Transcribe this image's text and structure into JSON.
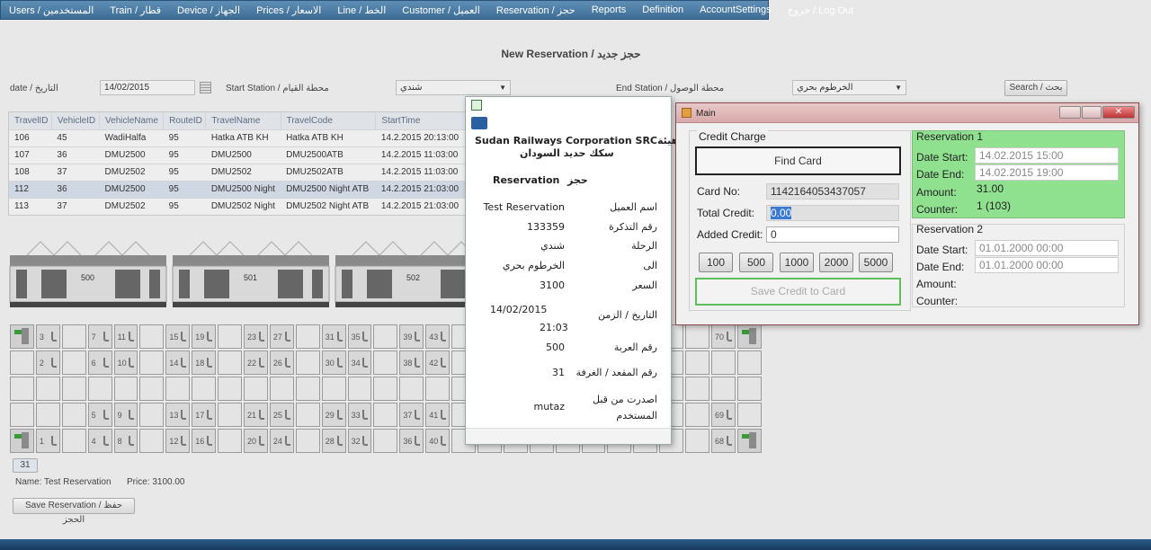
{
  "menu": [
    "Users / المستخدمين",
    "Train / قطار",
    "Device / الجهاز",
    "Prices / الاسعار",
    "Line / الخط",
    "Customer / العميل",
    "Reservation / حجز",
    "Reports",
    "Definition",
    "AccountSettings",
    "خروج / Log Out"
  ],
  "page_title": "New Reservation / حجز جديد",
  "filters": {
    "date_label": "date / التاريخ",
    "date_value": "14/02/2015",
    "start_label": "Start Station / محطة القيام",
    "start_value": "شندي",
    "end_label": "End Station / محطة الوصول",
    "end_value": "الخرطوم بحري",
    "search_label": "Search / بحث"
  },
  "grid": {
    "columns": [
      "TravelID",
      "VehicleID",
      "VehicleName",
      "RouteID",
      "TravelName",
      "TravelCode",
      "StartTime"
    ],
    "rows": [
      [
        "106",
        "45",
        "WadiHalfa",
        "95",
        "Hatka ATB KH",
        "Hatka ATB KH",
        "14.2.2015 20:13:00"
      ],
      [
        "107",
        "36",
        "DMU2500",
        "95",
        "DMU2500",
        "DMU2500ATB",
        "14.2.2015 11:03:00"
      ],
      [
        "108",
        "37",
        "DMU2502",
        "95",
        "DMU2502",
        "DMU2502ATB",
        "14.2.2015 11:03:00"
      ],
      [
        "112",
        "36",
        "DMU2500",
        "95",
        "DMU2500 Night",
        "DMU2500 Night ATB",
        "14.2.2015 21:03:00"
      ],
      [
        "113",
        "37",
        "DMU2502",
        "95",
        "DMU2502 Night",
        "DMU2502 Night ATB",
        "14.2.2015 21:03:00"
      ]
    ],
    "selected_row": 3
  },
  "cars": [
    "500",
    "501",
    "502"
  ],
  "seat_rows": [
    [
      "D",
      "3",
      "",
      "7",
      "11",
      "",
      "15",
      "19",
      "",
      "23",
      "27",
      "",
      "31",
      "35",
      "",
      "39",
      "43",
      "",
      "",
      "",
      "",
      "",
      "",
      "",
      "",
      "",
      "",
      "70",
      "D"
    ],
    [
      "",
      "2",
      "",
      "6",
      "10",
      "",
      "14",
      "18",
      "",
      "22",
      "26",
      "",
      "30",
      "34",
      "",
      "38",
      "42",
      "",
      "",
      "",
      "",
      "",
      "",
      "",
      "",
      "",
      "",
      "",
      ""
    ],
    [
      "",
      "",
      "",
      "",
      "",
      "",
      "",
      "",
      "",
      "",
      "",
      "",
      "",
      "",
      "",
      "",
      "",
      "",
      "",
      "",
      "",
      "",
      "",
      "",
      "",
      "",
      "",
      "",
      ""
    ],
    [
      "",
      "",
      "",
      "5",
      "9",
      "",
      "13",
      "17",
      "",
      "21",
      "25",
      "",
      "29",
      "33",
      "",
      "37",
      "41",
      "",
      "",
      "",
      "",
      "",
      "",
      "",
      "",
      "",
      "",
      "69",
      ""
    ],
    [
      "D",
      "1",
      "",
      "4",
      "8",
      "",
      "12",
      "16",
      "",
      "20",
      "24",
      "",
      "28",
      "32",
      "",
      "36",
      "40",
      "",
      "",
      "",
      "",
      "",
      "",
      "",
      "",
      "",
      "",
      "68",
      "D"
    ]
  ],
  "selected_seat": "31",
  "summary": {
    "name": "Name: Test Reservation",
    "price": "Price: 3100.00",
    "save": "Save Reservation / حفظ الحجز"
  },
  "ticket": {
    "company": "Sudan Railways Corporation SRCهيئة",
    "company2": "سكك حديد السودان",
    "heading_en": "Reservation",
    "heading_ar": "حجز",
    "rows": [
      {
        "label": "اسم العميل",
        "value": "Test Reservation"
      },
      {
        "label": "رقم التذكرة",
        "value": "133359"
      },
      {
        "label": "الرحلة",
        "value": "شندي"
      },
      {
        "label": "الى",
        "value": "الخرطوم بحري"
      },
      {
        "label": "السعر",
        "value": "3100"
      }
    ],
    "datetime_label": "التاريخ / الزمن",
    "date": "14/02/2015",
    "time": "21:03",
    "car_label": "رقم العربة",
    "car": "500",
    "seat_label": "رقم المقعد / الغرفة",
    "seat": "31",
    "issued_label1": "اصدرت من قبل",
    "issued_label2": "المستخدم",
    "issued_by": "mutaz"
  },
  "main_window": {
    "title": "Main",
    "credit_charge": "Credit Charge",
    "find_card": "Find Card",
    "card_no_label": "Card No:",
    "card_no": "1142164053437057",
    "total_credit_label": "Total Credit:",
    "total_credit": "0.00",
    "added_credit_label": "Added Credit:",
    "added_credit": "0",
    "amounts": [
      "100",
      "500",
      "1000",
      "2000",
      "5000"
    ],
    "save_credit": "Save Credit to Card",
    "res1": {
      "title": "Reservation 1",
      "date_start_label": "Date Start:",
      "date_start": "14.02.2015 15:00",
      "date_end_label": "Date End:",
      "date_end": "14.02.2015 19:00",
      "amount_label": "Amount:",
      "amount": "31.00",
      "counter_label": "Counter:",
      "counter": "1 (103)"
    },
    "res2": {
      "title": "Reservation 2",
      "date_start_label": "Date Start:",
      "date_start": "01.01.2000 00:00",
      "date_end_label": "Date End:",
      "date_end": "01.01.2000 00:00",
      "amount_label": "Amount:",
      "counter_label": "Counter:"
    }
  },
  "colors": {
    "menu": "#4a7aa3",
    "green": "#8fe08f",
    "accent": "#3a6ea5"
  }
}
